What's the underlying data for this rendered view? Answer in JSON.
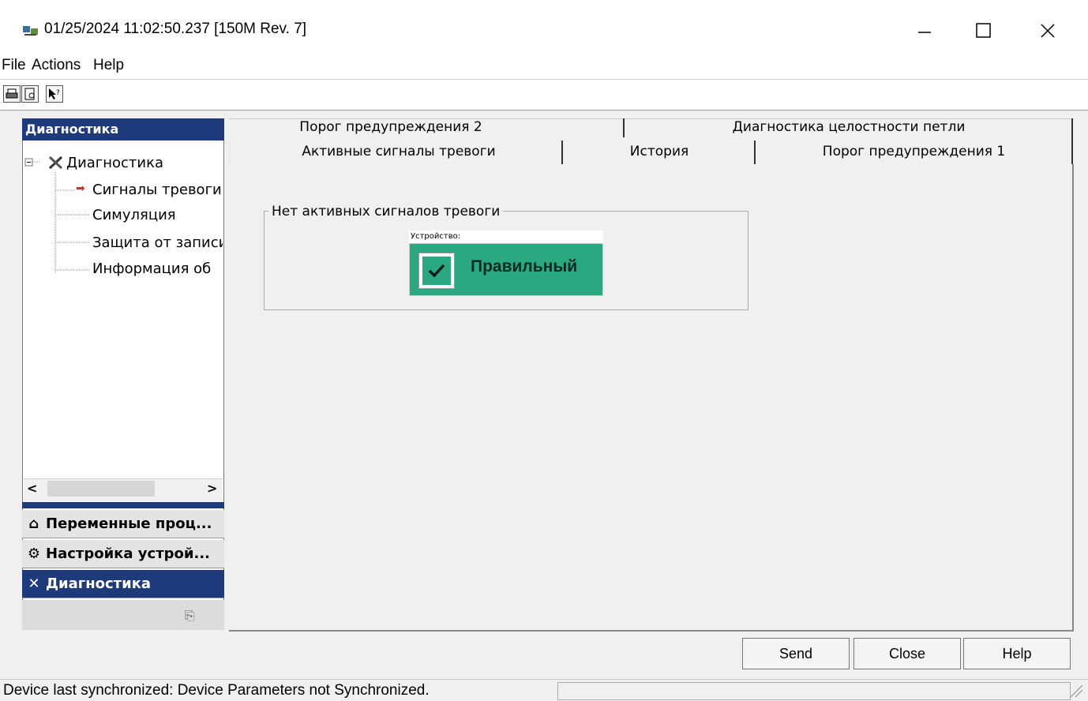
{
  "window": {
    "title": "01/25/2024 11:02:50.237 [150M Rev. 7]",
    "controls": {
      "minimize": "—",
      "maximize": "☐",
      "close": "✕"
    }
  },
  "menu": [
    "File",
    "Actions",
    "Help"
  ],
  "toolbar": [
    "print-icon",
    "print-preview-icon",
    "context-help-icon"
  ],
  "left_panel": {
    "header": "Диагностика",
    "tree": {
      "root": "Диагностика",
      "children": [
        "Сигналы тревоги",
        "Симуляция",
        "Защита от записи",
        "Информация об"
      ]
    },
    "nav_buttons": [
      "Переменные проц...",
      "Настройка устрой...",
      "Диагностика"
    ]
  },
  "tabs": {
    "row_back": [
      "Порог предупреждения 2",
      "Диагностика целостности петли"
    ],
    "row_front": [
      "Активные сигналы тревоги",
      "История",
      "Порог предупреждения 1"
    ],
    "active": "Активные сигналы тревоги"
  },
  "alarm_panel": {
    "group_title": "Нет активных сигналов тревоги",
    "device_label": "Устройство:",
    "status": "Правильный",
    "status_color": "#2ba880"
  },
  "buttons": {
    "send": "Send",
    "close": "Close",
    "help": "Help"
  },
  "status_bar": {
    "text": "Device last synchronized: Device Parameters not Synchronized."
  }
}
